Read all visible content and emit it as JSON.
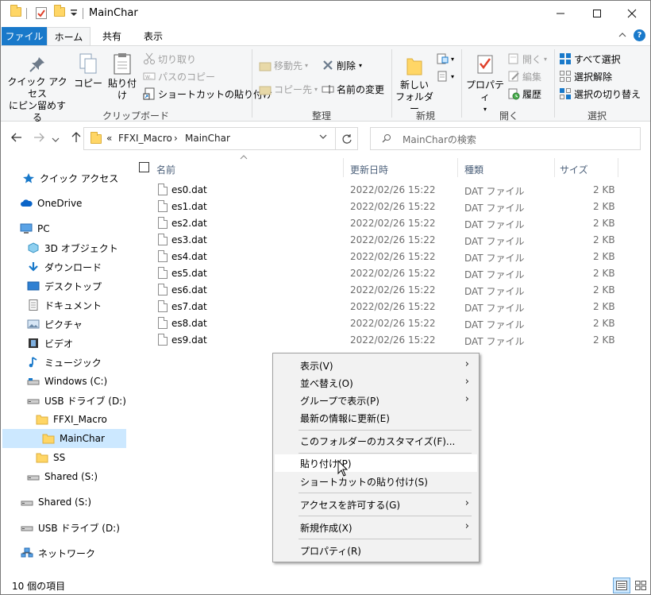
{
  "window": {
    "title": "MainChar",
    "minimize_label": "—",
    "maximize_label": "☐",
    "close_label": "✕"
  },
  "ribbon_tabs": {
    "file": "ファイル",
    "home": "ホーム",
    "share": "共有",
    "view": "表示"
  },
  "ribbon": {
    "clipboard": {
      "label": "クリップボード",
      "pin_quick_access_line1": "クイック アクセス",
      "pin_quick_access_line2": "にピン留めする",
      "copy": "コピー",
      "paste": "貼り付け",
      "cut": "切り取り",
      "copy_path": "パスのコピー",
      "paste_shortcut": "ショートカットの貼り付け"
    },
    "organize": {
      "label": "整理",
      "move_to": "移動先",
      "copy_to": "コピー先",
      "delete": "削除",
      "rename": "名前の変更"
    },
    "new": {
      "label": "新規",
      "new_folder_line1": "新しい",
      "new_folder_line2": "フォルダー"
    },
    "open": {
      "label": "開く",
      "properties": "プロパティ",
      "open": "開く",
      "edit": "編集",
      "history": "履歴"
    },
    "select": {
      "label": "選択",
      "select_all": "すべて選択",
      "select_none": "選択解除",
      "invert_selection": "選択の切り替え"
    }
  },
  "address": {
    "overflow": "«",
    "crumb1": "FFXI_Macro",
    "sep": "›",
    "crumb2": "MainChar",
    "search_placeholder": "MainCharの検索"
  },
  "nav_pane": {
    "items": [
      {
        "label": "クイック アクセス",
        "icon": "star-icon"
      },
      {
        "label": "OneDrive",
        "icon": "cloud-icon"
      },
      {
        "label": "PC",
        "icon": "pc-icon"
      },
      {
        "label": "3D オブジェクト",
        "icon": "cube-icon"
      },
      {
        "label": "ダウンロード",
        "icon": "download-icon"
      },
      {
        "label": "デスクトップ",
        "icon": "desktop-icon"
      },
      {
        "label": "ドキュメント",
        "icon": "document-icon"
      },
      {
        "label": "ピクチャ",
        "icon": "picture-icon"
      },
      {
        "label": "ビデオ",
        "icon": "video-icon"
      },
      {
        "label": "ミュージック",
        "icon": "music-icon"
      },
      {
        "label": "Windows (C:)",
        "icon": "drive-icon"
      },
      {
        "label": "USB ドライブ (D:)",
        "icon": "drive-icon"
      },
      {
        "label": "FFXI_Macro",
        "icon": "folder-icon"
      },
      {
        "label": "MainChar",
        "icon": "folder-icon"
      },
      {
        "label": "SS",
        "icon": "folder-icon"
      },
      {
        "label": "Shared (S:)",
        "icon": "drive-icon"
      },
      {
        "label": "Shared (S:)",
        "icon": "drive-icon"
      },
      {
        "label": "USB ドライブ (D:)",
        "icon": "drive-icon"
      },
      {
        "label": "ネットワーク",
        "icon": "network-icon"
      }
    ]
  },
  "file_list": {
    "columns": {
      "name": "名前",
      "modified": "更新日時",
      "type": "種類",
      "size": "サイズ"
    },
    "rows": [
      {
        "name": "es0.dat",
        "modified": "2022/02/26 15:22",
        "type": "DAT ファイル",
        "size": "2 KB"
      },
      {
        "name": "es1.dat",
        "modified": "2022/02/26 15:22",
        "type": "DAT ファイル",
        "size": "2 KB"
      },
      {
        "name": "es2.dat",
        "modified": "2022/02/26 15:22",
        "type": "DAT ファイル",
        "size": "2 KB"
      },
      {
        "name": "es3.dat",
        "modified": "2022/02/26 15:22",
        "type": "DAT ファイル",
        "size": "2 KB"
      },
      {
        "name": "es4.dat",
        "modified": "2022/02/26 15:22",
        "type": "DAT ファイル",
        "size": "2 KB"
      },
      {
        "name": "es5.dat",
        "modified": "2022/02/26 15:22",
        "type": "DAT ファイル",
        "size": "2 KB"
      },
      {
        "name": "es6.dat",
        "modified": "2022/02/26 15:22",
        "type": "DAT ファイル",
        "size": "2 KB"
      },
      {
        "name": "es7.dat",
        "modified": "2022/02/26 15:22",
        "type": "DAT ファイル",
        "size": "2 KB"
      },
      {
        "name": "es8.dat",
        "modified": "2022/02/26 15:22",
        "type": "DAT ファイル",
        "size": "2 KB"
      },
      {
        "name": "es9.dat",
        "modified": "2022/02/26 15:22",
        "type": "DAT ファイル",
        "size": "2 KB"
      }
    ]
  },
  "context_menu": {
    "view": "表示(V)",
    "sort_by": "並べ替え(O)",
    "group_by": "グループで表示(P)",
    "refresh": "最新の情報に更新(E)",
    "customize": "このフォルダーのカスタマイズ(F)...",
    "paste": "貼り付け(P)",
    "paste_shortcut": "ショートカットの貼り付け(S)",
    "give_access": "アクセスを許可する(G)",
    "new": "新規作成(X)",
    "properties": "プロパティ(R)"
  },
  "status": {
    "item_count": "10 個の項目"
  },
  "colors": {
    "accent": "#1979ca",
    "selection": "#cce8ff",
    "folder": "#ffd666"
  }
}
